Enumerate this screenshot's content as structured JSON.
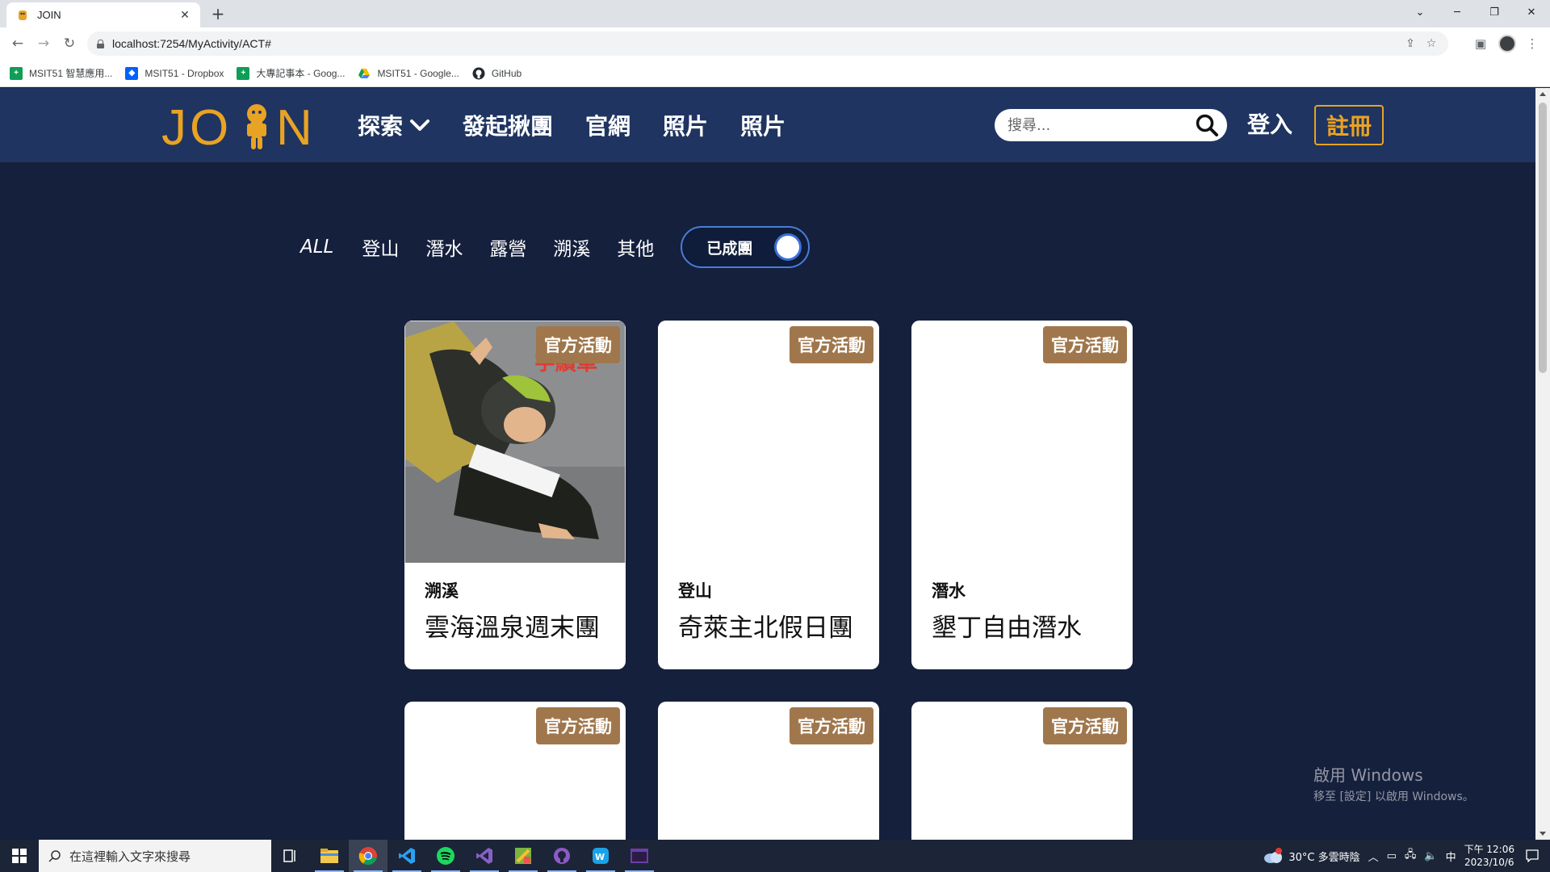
{
  "browser": {
    "tab_title": "JOIN",
    "url": "localhost:7254/MyActivity/ACT#",
    "bookmarks": [
      {
        "label": "MSIT51 智慧應用...",
        "color": "#0f9d58"
      },
      {
        "label": "MSIT51 - Dropbox",
        "color": "#0061fe"
      },
      {
        "label": "大專記事本 - Goog...",
        "color": "#0f9d58"
      },
      {
        "label": "MSIT51 - Google...",
        "color": "#fbbc04"
      },
      {
        "label": "GitHub",
        "color": "#24292f"
      }
    ]
  },
  "site": {
    "logo_text": "JOIN",
    "nav": {
      "explore": "探索",
      "start_group": "發起揪團",
      "official": "官網",
      "photos1": "照片",
      "photos2": "照片"
    },
    "search_placeholder": "搜尋...",
    "login": "登入",
    "register": "註冊",
    "colors": {
      "header_bg": "#1f3460",
      "page_bg": "#15203d",
      "accent": "#e9a324",
      "badge": "#a0774c"
    }
  },
  "filters": {
    "items": [
      "ALL",
      "登山",
      "潛水",
      "露營",
      "溯溪",
      "其他"
    ],
    "toggle_label": "已成團",
    "toggle_on": true
  },
  "cards": [
    {
      "badge": "官方活動",
      "category": "溯溪",
      "title": "雲海溫泉週末團",
      "has_image": true
    },
    {
      "badge": "官方活動",
      "category": "登山",
      "title": "奇萊主北假日團",
      "has_image": false
    },
    {
      "badge": "官方活動",
      "category": "潛水",
      "title": "墾丁自由潛水",
      "has_image": false
    },
    {
      "badge": "官方活動",
      "category": "",
      "title": "",
      "has_image": false
    },
    {
      "badge": "官方活動",
      "category": "",
      "title": "",
      "has_image": false
    },
    {
      "badge": "官方活動",
      "category": "",
      "title": "",
      "has_image": false
    }
  ],
  "watermark": {
    "title": "啟用 Windows",
    "subtitle": "移至 [設定] 以啟用 Windows。"
  },
  "taskbar": {
    "search_placeholder": "在這裡輸入文字來搜尋",
    "weather": "30°C 多雲時陰",
    "ime": "中",
    "time": "下午 12:06",
    "date": "2023/10/6"
  }
}
